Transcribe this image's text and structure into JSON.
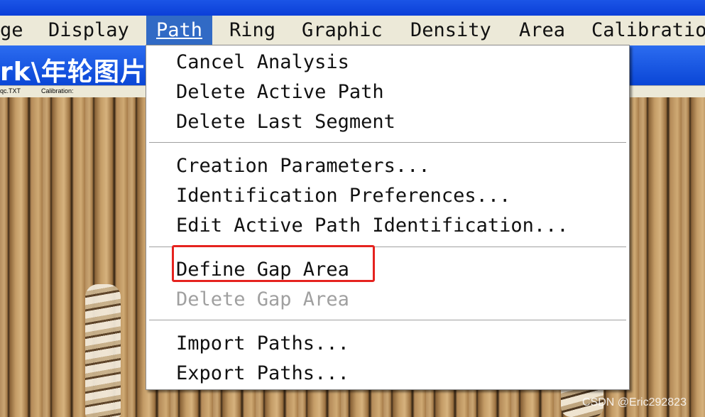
{
  "menubar": {
    "items": [
      {
        "label": "ge"
      },
      {
        "label": "Display"
      },
      {
        "label": "Path"
      },
      {
        "label": "Ring"
      },
      {
        "label": "Graphic"
      },
      {
        "label": "Density"
      },
      {
        "label": "Area"
      },
      {
        "label": "Calibratio"
      }
    ]
  },
  "document": {
    "title": "rk\\年轮图片"
  },
  "statusbar": {
    "file": "qc.TXT",
    "calibration_label": "Calibration:"
  },
  "path_menu": {
    "items": [
      {
        "label": "Cancel Analysis",
        "enabled": true
      },
      {
        "label": "Delete Active Path",
        "enabled": true
      },
      {
        "label": "Delete Last Segment",
        "enabled": true
      },
      {
        "label": "Creation Parameters...",
        "enabled": true
      },
      {
        "label": "Identification Preferences...",
        "enabled": true
      },
      {
        "label": "Edit Active Path Identification...",
        "enabled": true
      },
      {
        "label": "Define Gap Area",
        "enabled": true
      },
      {
        "label": "Delete Gap Area",
        "enabled": false
      },
      {
        "label": "Import Paths...",
        "enabled": true
      },
      {
        "label": "Export Paths...",
        "enabled": true
      }
    ]
  },
  "annotation": {
    "highlight_color": "#e5231f"
  },
  "watermark": "CSDN @Eric292823"
}
